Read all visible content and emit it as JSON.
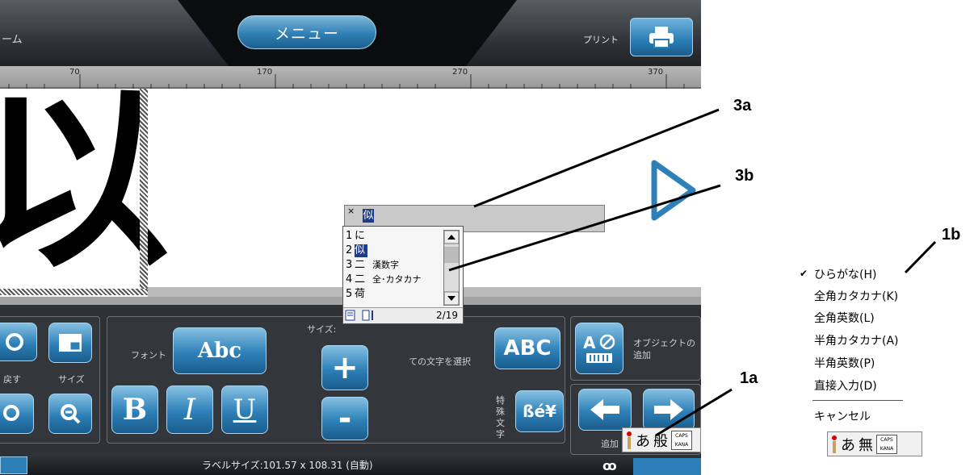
{
  "topbar": {
    "home_label": "ーム",
    "menu_label": "メニュー",
    "print_label": "プリント"
  },
  "ruler": {
    "ticks": [
      "70",
      "170",
      "270",
      "370"
    ]
  },
  "canvas": {
    "big_char": "以"
  },
  "toolbar": {
    "back_label": "戻す",
    "size_label": "サイズ",
    "font_label": "フォント",
    "font_button": "Abc",
    "bold_button": "B",
    "italic_button": "I",
    "underline_button": "U",
    "size_heading": "サイズ:",
    "plus_button": "+",
    "minus_button": "-",
    "select_all_label": "ての文字を選択",
    "select_all_button": "ABC",
    "add_object_label": "オブジェクトの追加",
    "special_label": "特殊文字",
    "special_button": "ßé¥",
    "add_label": "追加"
  },
  "ime": {
    "close": "×",
    "composition": "似",
    "candidates": [
      {
        "n": "1",
        "ch": "に",
        "ann": ""
      },
      {
        "n": "2",
        "ch": "似",
        "ann": ""
      },
      {
        "n": "3",
        "ch": "二",
        "ann": "漢数字"
      },
      {
        "n": "4",
        "ch": "二",
        "ann": "全･カタカナ"
      },
      {
        "n": "5",
        "ch": "荷",
        "ann": ""
      }
    ],
    "page": "2/19"
  },
  "ime_bar_screen": {
    "mode": "あ",
    "kind": "般",
    "caps1": "CAPS",
    "caps2": "KANA"
  },
  "ime_bar_side": {
    "mode": "あ",
    "kind": "無",
    "caps1": "CAPS",
    "caps2": "KANA"
  },
  "mode_menu": {
    "items": [
      "ひらがな(H)",
      "全角カタカナ(K)",
      "全角英数(L)",
      "半角カタカナ(A)",
      "半角英数(P)",
      "直接入力(D)"
    ],
    "cancel": "キャンセル",
    "checked": "✔"
  },
  "status": {
    "label_size": "ラベルサイズ:101.57 x 108.31 (自動)",
    "tape": "ꝏ"
  },
  "callouts": {
    "c3a": "3a",
    "c3b": "3b",
    "c1a": "1a",
    "c1b": "1b"
  },
  "colors": {
    "accent_blue": "#2d80b8",
    "ime_select": "#1e3b8c"
  }
}
